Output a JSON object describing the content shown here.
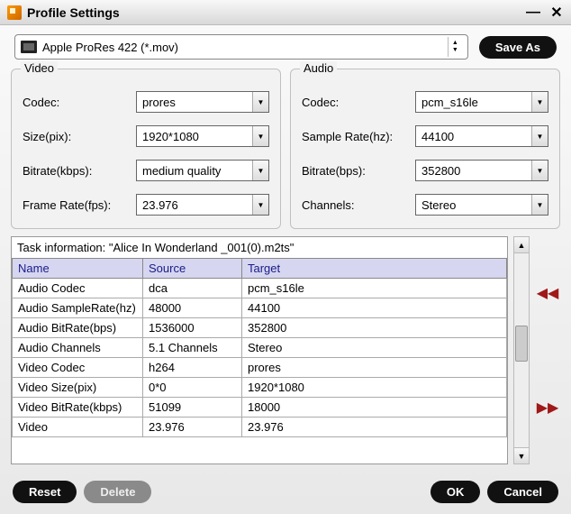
{
  "titlebar": {
    "title": "Profile Settings"
  },
  "profile": {
    "name": "Apple ProRes 422 (*.mov)"
  },
  "buttons": {
    "save_as": "Save As",
    "reset": "Reset",
    "delete": "Delete",
    "ok": "OK",
    "cancel": "Cancel"
  },
  "video": {
    "group_title": "Video",
    "codec_label": "Codec:",
    "codec_value": "prores",
    "size_label": "Size(pix):",
    "size_value": "1920*1080",
    "bitrate_label": "Bitrate(kbps):",
    "bitrate_value": "medium quality",
    "framerate_label": "Frame Rate(fps):",
    "framerate_value": "23.976"
  },
  "audio": {
    "group_title": "Audio",
    "codec_label": "Codec:",
    "codec_value": "pcm_s16le",
    "samplerate_label": "Sample Rate(hz):",
    "samplerate_value": "44100",
    "bitrate_label": "Bitrate(bps):",
    "bitrate_value": "352800",
    "channels_label": "Channels:",
    "channels_value": "Stereo"
  },
  "task": {
    "header": "Task information: \"Alice In Wonderland _001(0).m2ts\"",
    "columns": {
      "name": "Name",
      "source": "Source",
      "target": "Target"
    },
    "rows": [
      {
        "name": "Audio Codec",
        "source": "dca",
        "target": "pcm_s16le"
      },
      {
        "name": "Audio SampleRate(hz)",
        "source": "48000",
        "target": "44100"
      },
      {
        "name": "Audio BitRate(bps)",
        "source": "1536000",
        "target": "352800"
      },
      {
        "name": "Audio Channels",
        "source": "5.1 Channels",
        "target": "Stereo"
      },
      {
        "name": "Video Codec",
        "source": "h264",
        "target": "prores"
      },
      {
        "name": "Video Size(pix)",
        "source": "0*0",
        "target": "1920*1080"
      },
      {
        "name": "Video BitRate(kbps)",
        "source": "51099",
        "target": "18000"
      },
      {
        "name": "Video",
        "source": "23.976",
        "target": "23.976"
      }
    ]
  }
}
